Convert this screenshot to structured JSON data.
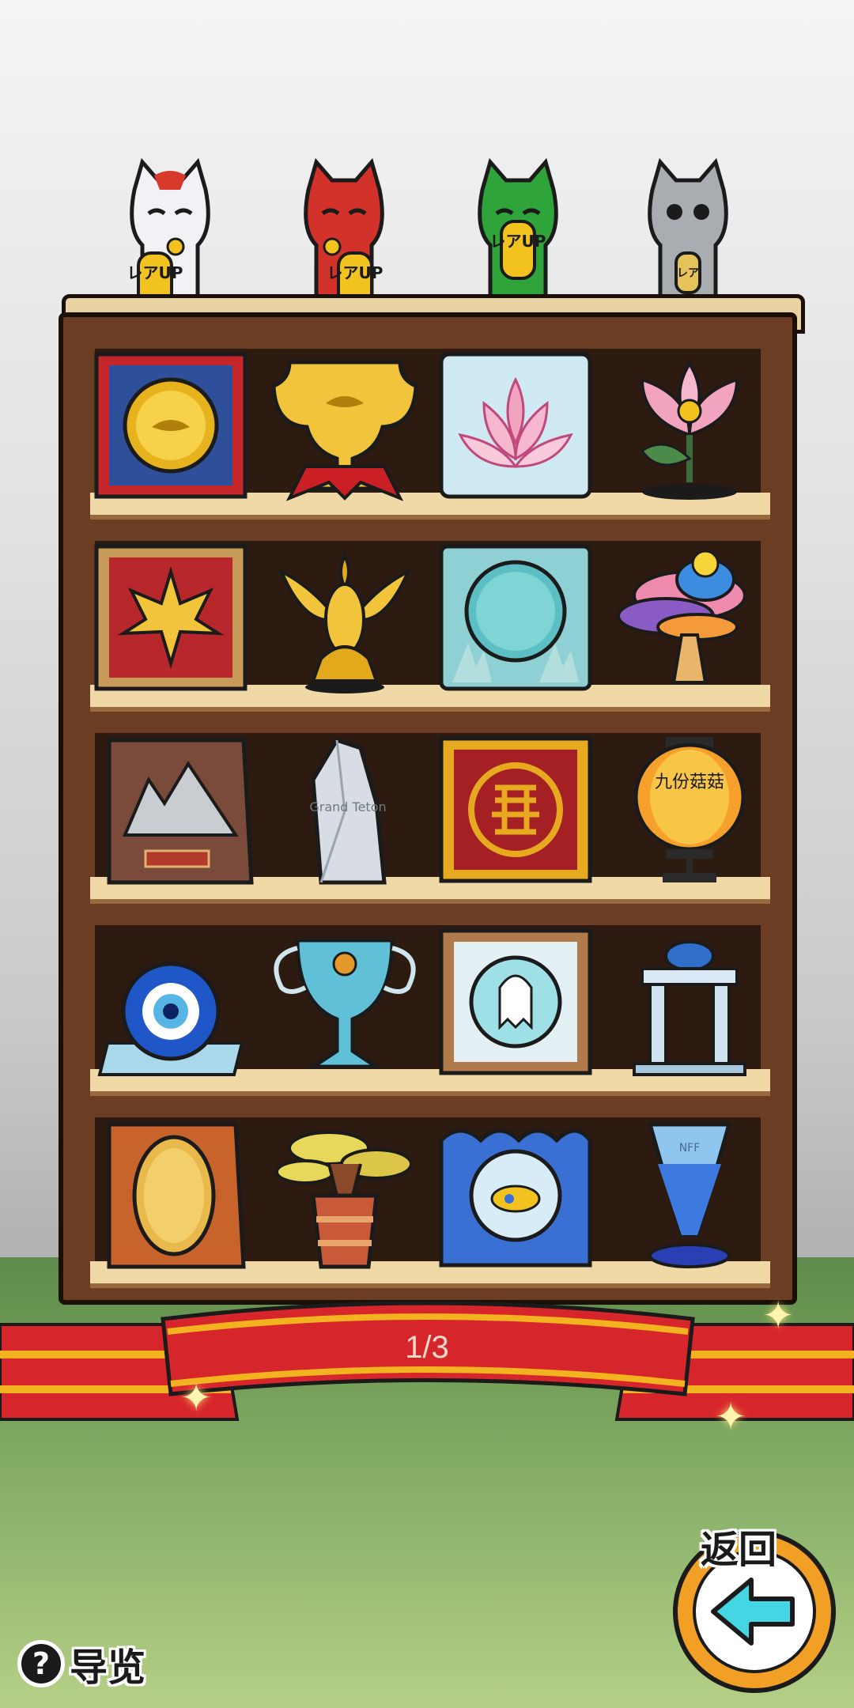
{
  "colors": {
    "wood": "#6b3d22",
    "plank": "#f0d9a7",
    "ribbon_red": "#d7262b",
    "ribbon_gold": "#f3b321",
    "back_arrow": "#43d6e3"
  },
  "cats": [
    {
      "name": "white-maneki-neko-icon",
      "body": "#f2f2f6",
      "accent": "#d9392b",
      "tag": "レアUP"
    },
    {
      "name": "red-maneki-neko-icon",
      "body": "#d3322a",
      "accent": "#1b1b1b",
      "tag": "レアUP"
    },
    {
      "name": "green-maneki-neko-icon",
      "body": "#2fa43b",
      "accent": "#1b1b1b",
      "tag": "レアUP"
    },
    {
      "name": "silver-maneki-neko-icon",
      "body": "#a9adb2",
      "accent": "#e6c35a",
      "tag": "レア"
    }
  ],
  "shelf": {
    "rows": [
      [
        "gold-medal-frame-icon",
        "gold-trophy-cup-icon",
        "lotus-plaque-icon",
        "lotus-flower-statue-icon"
      ],
      [
        "maple-leaf-frame-icon",
        "golden-phoenix-statue-icon",
        "coral-mirror-plaque-icon",
        "coral-reef-ornament-icon"
      ],
      [
        "mountain-plaque-icon",
        "grand-teton-crystal-icon",
        "double-happiness-frame-icon",
        "chinese-lantern-icon"
      ],
      [
        "evil-eye-ornament-icon",
        "blue-crystal-trophy-icon",
        "ghost-portrait-frame-icon",
        "white-gazebo-icon"
      ],
      [
        "madagascar-coin-plaque-icon",
        "baobab-bonsai-icon",
        "submarine-wave-plaque-icon",
        "blue-glass-vase-icon"
      ]
    ],
    "engravings": {
      "teton": "Grand Teton",
      "lantern": "九份菇菇",
      "vase": "NFF"
    }
  },
  "pagination": {
    "label": "1/3"
  },
  "guide": {
    "label": "导览",
    "icon": "?"
  },
  "back": {
    "label": "返回"
  }
}
